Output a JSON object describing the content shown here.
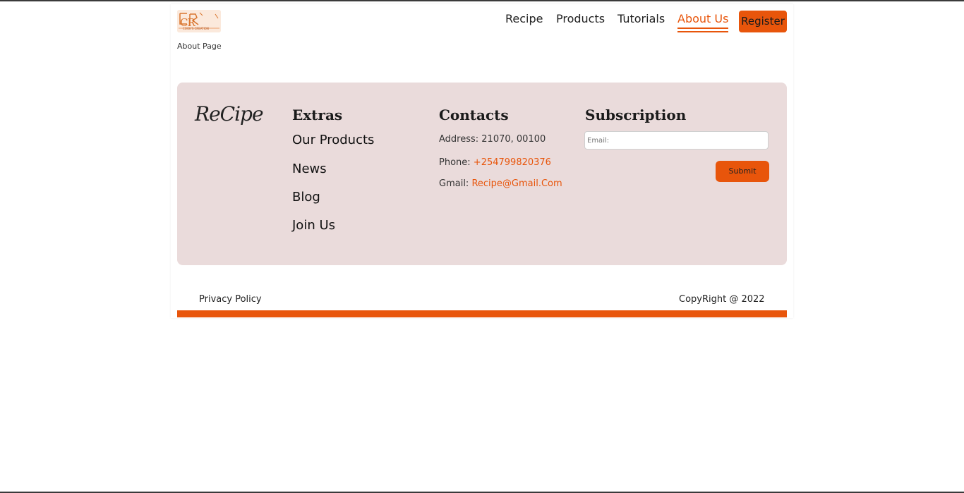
{
  "header": {
    "logo_text": "CR",
    "logo_subtext": "COOK'S CREATION",
    "page_label": "About Page"
  },
  "nav": {
    "items": [
      {
        "label": "Recipe"
      },
      {
        "label": "Products"
      },
      {
        "label": "Tutorials"
      },
      {
        "label": "About Us",
        "active": true
      }
    ],
    "register_label": "Register"
  },
  "footer": {
    "brand": "ReCipe",
    "extras": {
      "heading": "Extras",
      "links": [
        "Our Products",
        "News",
        "Blog",
        "Join Us"
      ]
    },
    "contacts": {
      "heading": "Contacts",
      "address": "Address: 21070, 00100",
      "phone_label": "Phone:",
      "phone_value": "+254799820376",
      "gmail_label": "Gmail:",
      "gmail_value": "Recipe@Gmail.Com"
    },
    "subscription": {
      "heading": "Subscription",
      "email_placeholder": "Email:",
      "submit_label": "Submit"
    }
  },
  "bottom": {
    "privacy": "Privacy Policy",
    "copyright": "CopyRight @ 2022"
  },
  "colors": {
    "accent": "#e8550b",
    "footer_bg": "#eadbdb"
  }
}
